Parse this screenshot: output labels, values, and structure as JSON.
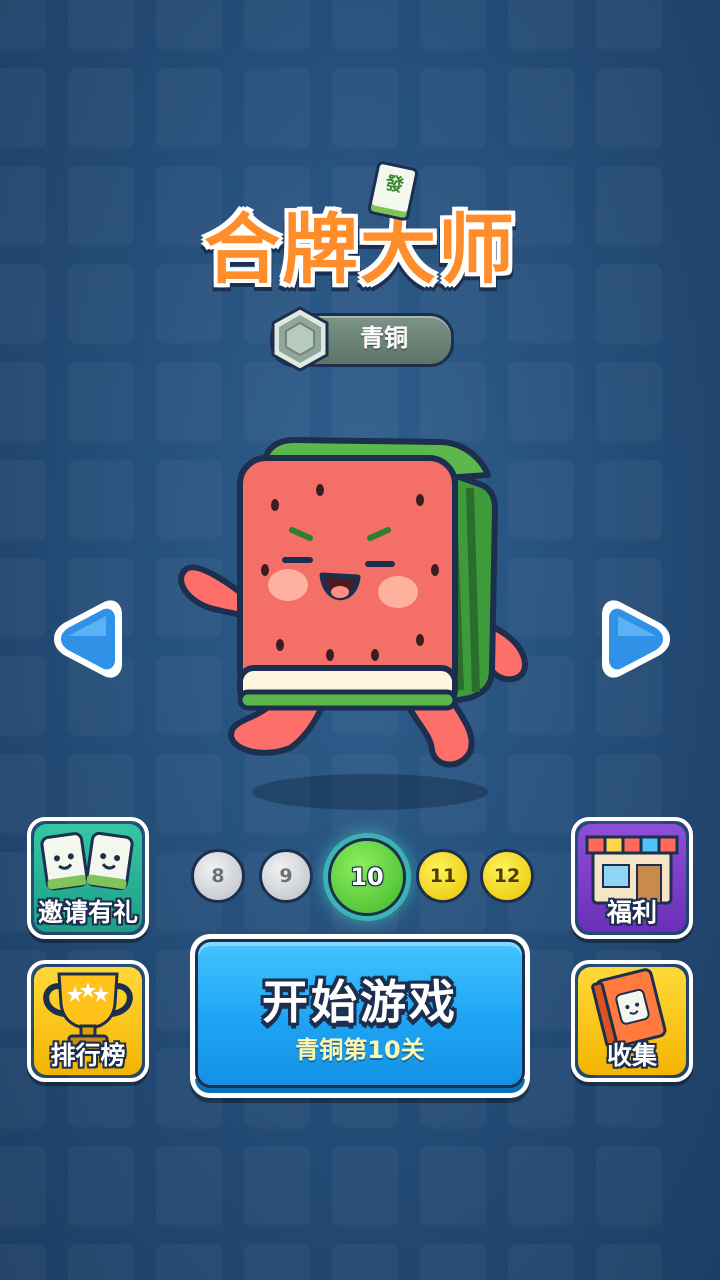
{
  "game": {
    "title": "合牌大师",
    "title_tile_glyph": "發"
  },
  "rank": {
    "name": "青铜",
    "badge_icon": "bronze-hexagon-badge"
  },
  "mascot": {
    "icon": "watermelon-cube-character"
  },
  "navigation": {
    "prev_icon": "triangle-left-icon",
    "next_icon": "triangle-right-icon"
  },
  "side_buttons": {
    "invite": {
      "label": "邀请有礼",
      "icon": "mahjong-friends-icon"
    },
    "welfare": {
      "label": "福利",
      "icon": "shop-icon"
    },
    "leaderboard": {
      "label": "排行榜",
      "icon": "trophy-icon"
    },
    "collection": {
      "label": "收集",
      "icon": "book-icon"
    }
  },
  "levels": [
    {
      "number": "8",
      "state": "past"
    },
    {
      "number": "9",
      "state": "past"
    },
    {
      "number": "10",
      "state": "current"
    },
    {
      "number": "11",
      "state": "next"
    },
    {
      "number": "12",
      "state": "next"
    }
  ],
  "start": {
    "label": "开始游戏",
    "sublabel": "青铜第10关"
  },
  "colors": {
    "background": "#27527e",
    "outline": "#1c2f4e",
    "start_button": "#1ea4f4",
    "current_level": "#3fb62a",
    "next_level": "#e9c400",
    "past_level": "#b9bec4",
    "logo_orange": "#ff8d2b"
  }
}
